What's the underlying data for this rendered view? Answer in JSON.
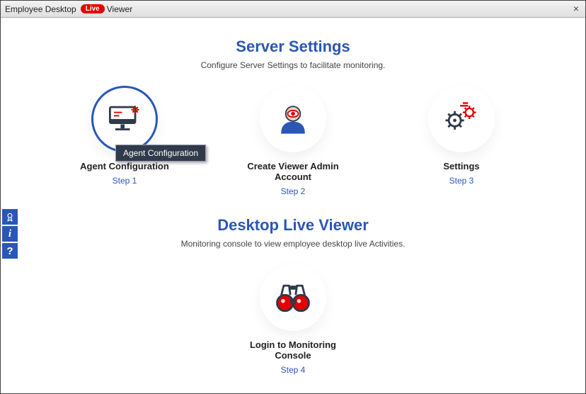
{
  "titlebar": {
    "app_prefix": "Employee Desktop",
    "live_badge": "Live",
    "app_suffix": "Viewer",
    "close": "×"
  },
  "section1": {
    "heading": "Server Settings",
    "sub": "Configure Server Settings to facilitate monitoring.",
    "cards": [
      {
        "title": "Agent Configuration",
        "step": "Step 1"
      },
      {
        "title": "Create Viewer Admin Account",
        "step": "Step 2"
      },
      {
        "title": "Settings",
        "step": "Step 3"
      }
    ]
  },
  "tooltip": {
    "agent_config": "Agent Configuration"
  },
  "section2": {
    "heading": "Desktop Live Viewer",
    "sub": "Monitoring console to view employee desktop live Activities.",
    "card": {
      "title": "Login to Monitoring Console",
      "step": "Step 4"
    }
  },
  "sidebar": {
    "award": "award-icon",
    "info": "i",
    "help": "?"
  }
}
